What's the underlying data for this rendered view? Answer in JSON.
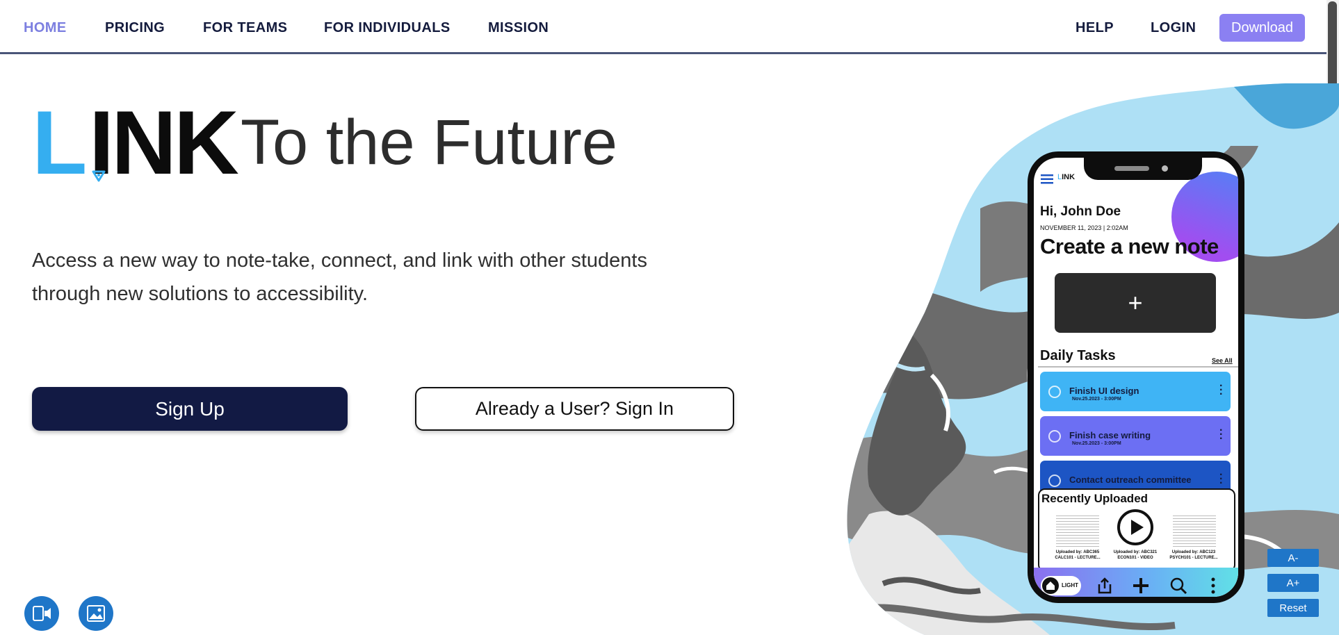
{
  "nav": {
    "home": "HOME",
    "pricing": "PRICING",
    "for_teams": "FOR TEAMS",
    "for_individuals": "FOR INDIVIDUALS",
    "mission": "MISSION",
    "help": "HELP",
    "login": "LOGIN",
    "download": "Download",
    "active": "HOME"
  },
  "hero": {
    "logo_first": "L",
    "logo_rest": "INK",
    "tagline": "To the Future",
    "description": "Access a new way to note-take, connect, and link with other students through new solutions to accessibility.",
    "signup": "Sign Up",
    "signin": "Already a User? Sign In"
  },
  "phone": {
    "logo_first": "L",
    "logo_rest": "INK",
    "greeting": "Hi, John Doe",
    "date": "NOVEMBER 11, 2023 | 2:02AM",
    "create_note": "Create a new note",
    "plus": "+",
    "daily_tasks": "Daily Tasks",
    "see_all": "See All",
    "tasks": [
      {
        "title": "Finish UI design",
        "date": "Nov.25.2023 - 3:00PM",
        "color": "#3fb4f5"
      },
      {
        "title": "Finish case writing",
        "date": "Nov.25.2023 - 3:00PM",
        "color": "#6c6ff3"
      },
      {
        "title": "Contact outreach committee",
        "date": "",
        "color": "#1d55c4"
      }
    ],
    "recently_uploaded": "Recently Uploaded",
    "uploads": [
      {
        "by": "Uploaded by: ABC365",
        "name": "CALC101 - LECTURE..."
      },
      {
        "by": "Uploaded by: ABC321",
        "name": "ECON101 - VIDEO"
      },
      {
        "by": "Uploaded by: ABC123",
        "name": "PSYCH101 - LECTURE..."
      }
    ],
    "theme_label": "LIGHT",
    "tab_icons": [
      "home-icon",
      "share-icon",
      "add-icon",
      "search-icon",
      "more-icon"
    ]
  },
  "accessibility": {
    "decrease": "A-",
    "increase": "A+",
    "reset": "Reset",
    "icons": [
      "text-to-speech-icon",
      "image-description-icon"
    ]
  },
  "colors": {
    "accent": "#8b80f2",
    "primary_dark": "#121a44",
    "brand_blue": "#35aef0",
    "control_blue": "#1f76c8"
  }
}
